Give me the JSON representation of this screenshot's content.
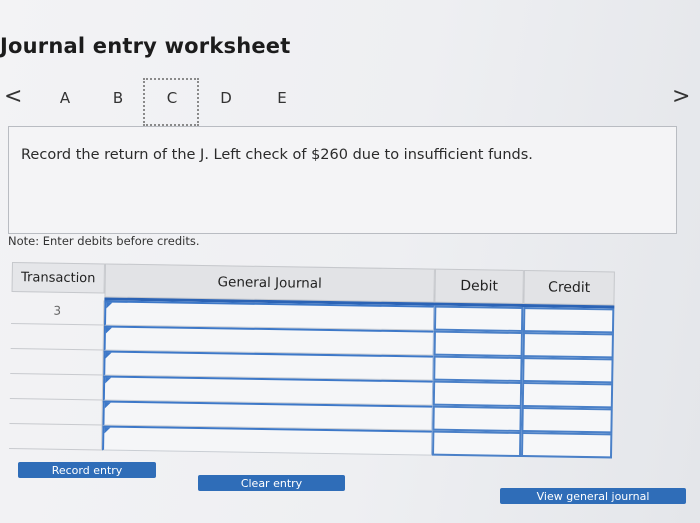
{
  "worksheet": {
    "title": "Journal entry worksheet",
    "nav_prev": "<",
    "nav_next": ">",
    "tabs": [
      "A",
      "B",
      "C",
      "D",
      "E"
    ],
    "active_tab": "C",
    "prompt": "Record the return of the J. Left check of $260 due to insufficient funds.",
    "note": "Note: Enter debits before credits."
  },
  "table": {
    "headers": {
      "transaction": "Transaction",
      "general_journal": "General Journal",
      "debit": "Debit",
      "credit": "Credit"
    },
    "rows": [
      {
        "transaction": "3",
        "account": "",
        "debit": "",
        "credit": ""
      },
      {
        "transaction": "",
        "account": "",
        "debit": "",
        "credit": ""
      },
      {
        "transaction": "",
        "account": "",
        "debit": "",
        "credit": ""
      },
      {
        "transaction": "",
        "account": "",
        "debit": "",
        "credit": ""
      },
      {
        "transaction": "",
        "account": "",
        "debit": "",
        "credit": ""
      },
      {
        "transaction": "",
        "account": "",
        "debit": "",
        "credit": ""
      }
    ]
  },
  "buttons": {
    "record": "Record entry",
    "clear": "Clear entry",
    "view": "View general journal"
  },
  "colors": {
    "accent": "#2f6db8",
    "cell_border": "#4a80c8",
    "header_bg": "#e2e3e6"
  }
}
